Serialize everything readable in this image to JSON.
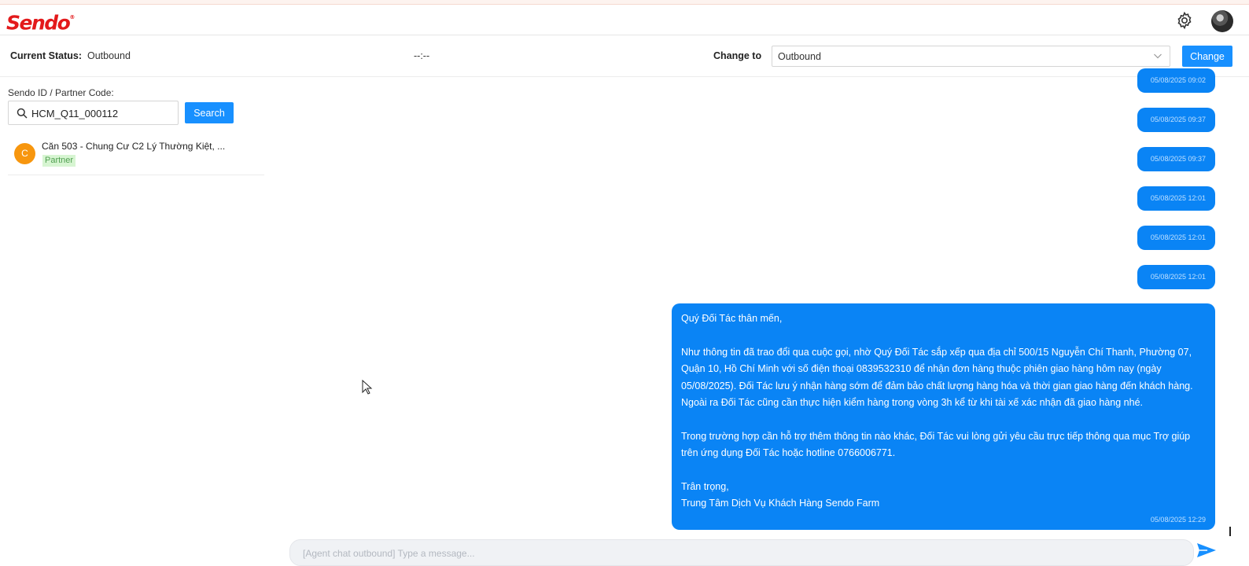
{
  "app": {
    "logo_text": "Sendo",
    "logo_mark": "®",
    "brand_color": "#e3191b",
    "accent_color": "#1890ff"
  },
  "header": {
    "settings_icon": "gear-icon",
    "avatar_icon": "user-avatar"
  },
  "status": {
    "current_label": "Current Status:",
    "current_value": "Outbound",
    "timer": "--:--",
    "change_label": "Change to",
    "change_selected": "Outbound",
    "change_button": "Change"
  },
  "search": {
    "label": "Sendo ID / Partner Code:",
    "value": "HCM_Q11_000112",
    "button": "Search"
  },
  "results": [
    {
      "initial": "C",
      "name": "Căn 503 - Chung Cư C2 Lý Thường Kiệt, ...",
      "tag": "Partner"
    }
  ],
  "messages": {
    "pills": [
      "05/08/2025 09:02",
      "05/08/2025 09:37",
      "05/08/2025 09:37",
      "05/08/2025 12:01",
      "05/08/2025 12:01",
      "05/08/2025 12:01"
    ],
    "main": {
      "greeting": "Quý Đối Tác thân mến,",
      "para1_l1": "Như thông tin đã trao đổi qua cuộc gọi, nhờ Quý Đối Tác sắp xếp qua địa chỉ 500/15 Nguyễn Chí Thanh, Phường 07,",
      "para1_l2": "Quận 10, Hồ Chí Minh với số điện thoại 0839532310 để nhận đơn hàng thuộc phiên giao hàng hôm nay (ngày",
      "para1_l3": "05/08/2025). Đối Tác lưu ý nhận hàng sớm để đảm bảo chất lượng hàng hóa và thời gian giao hàng đến khách hàng.",
      "para1_l4": "Ngoài ra Đối Tác cũng cần thực hiện kiểm hàng trong vòng 3h kể từ khi tài xế xác nhận đã giao hàng nhé.",
      "para2_l1": "Trong trường hợp cần hỗ trợ thêm thông tin nào khác, Đối Tác vui lòng gửi yêu cầu trực tiếp thông qua mục Trợ giúp",
      "para2_l2": "trên ứng dụng Đối Tác hoặc hotline 0766006771.",
      "closing": "Trân trọng,",
      "signature": "Trung Tâm Dịch Vụ Khách Hàng Sendo Farm",
      "time": "05/08/2025 12:29"
    }
  },
  "composer": {
    "placeholder": "[Agent chat outbound] Type a message...",
    "send_icon": "send-icon"
  }
}
